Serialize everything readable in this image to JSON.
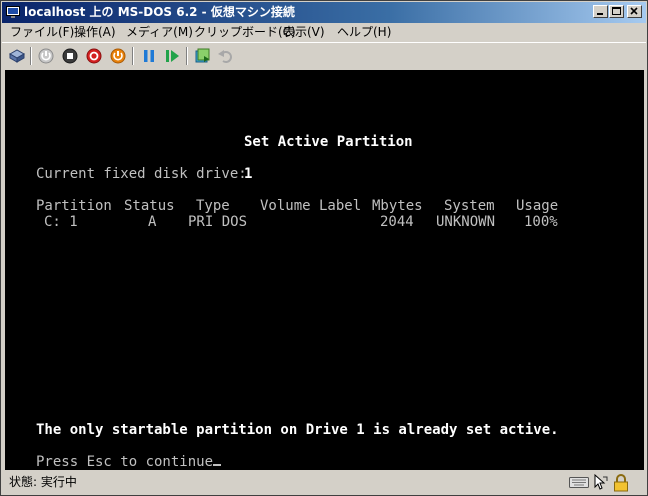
{
  "window": {
    "title": "localhost 上の MS-DOS 6.2 - 仮想マシン接続"
  },
  "menubar": {
    "items": [
      "ファイル(F)",
      "操作(A)",
      "メディア(M)",
      "クリップボード(C)",
      "表示(V)",
      "ヘルプ(H)"
    ]
  },
  "toolbar": {
    "icons": [
      "ctrl-alt-del-icon",
      "start-icon",
      "turn-off-icon",
      "shut-down-icon",
      "reset-icon",
      "pause-icon",
      "resume-icon",
      "snapshot-icon",
      "revert-icon"
    ]
  },
  "console": {
    "heading": "Set Active Partition",
    "drive_line": "Current fixed disk drive: ",
    "drive_number": "1",
    "columns": [
      "Partition",
      "Status",
      "Type",
      "Volume Label",
      "Mbytes",
      "System",
      "Usage"
    ],
    "row": {
      "partition": "C: 1",
      "status": "A",
      "type": "PRI DOS",
      "volume_label": "",
      "mbytes": "2044",
      "system": "UNKNOWN",
      "usage": "100%"
    },
    "message": "The only startable partition on Drive 1 is already set active.",
    "prompt": "Press Esc to continue"
  },
  "statusbar": {
    "text": "状態: 実行中"
  },
  "colors": {
    "titlebar_start": "#0a246a",
    "titlebar_end": "#a6caf0",
    "console_bg": "#000000",
    "console_text": "#c0c0c0",
    "console_bright": "#ffffff"
  }
}
